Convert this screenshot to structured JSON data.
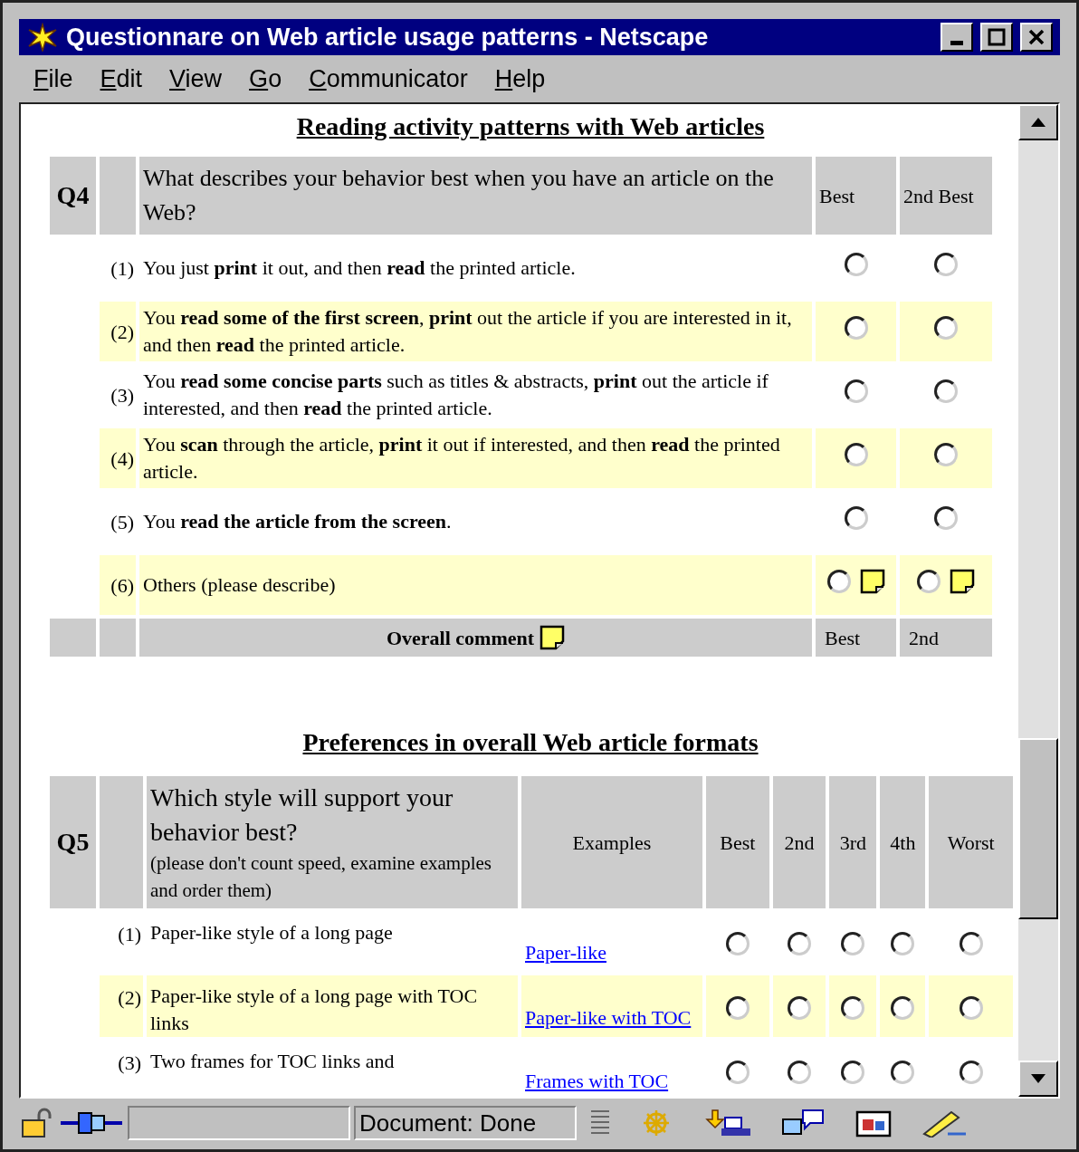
{
  "window": {
    "title": "Questionnare on Web article usage patterns - Netscape"
  },
  "menu": [
    "File",
    "Edit",
    "View",
    "Go",
    "Communicator",
    "Help"
  ],
  "section_1": {
    "title": "Reading activity patterns with Web articles",
    "question": {
      "number": "Q4",
      "text": "What describes your behavior best when you have an article on the Web?",
      "columns": [
        "Best",
        "2nd Best"
      ]
    },
    "rows": [
      {
        "label": "(1)",
        "text": "You just **print** it out, and then  **read** the printed article.",
        "highlighted": false,
        "note": false,
        "choices": [
          {
            "selected": false
          },
          {
            "selected": false
          }
        ]
      },
      {
        "label": "(2)",
        "text": "You **read some of the first screen**, **print** out the article if you are interested in it, and then **read** the printed article.",
        "highlighted": true,
        "note": false,
        "choices": [
          {
            "selected": false
          },
          {
            "selected": false
          }
        ]
      },
      {
        "label": "(3)",
        "text": "You **read some concise parts** such as titles & abstracts, **print** out the article if interested, and then **read** the printed article.",
        "highlighted": false,
        "note": false,
        "choices": [
          {
            "selected": false
          },
          {
            "selected": false
          }
        ]
      },
      {
        "label": "(4)",
        "text": "You **scan** through the article, **print** it out if interested, and then **read** the printed article.",
        "highlighted": true,
        "note": false,
        "choices": [
          {
            "selected": false
          },
          {
            "selected": false
          }
        ]
      },
      {
        "label": "(5)",
        "text": "You **read the article from the screen**.",
        "highlighted": false,
        "note": false,
        "choices": [
          {
            "selected": false
          },
          {
            "selected": false
          }
        ]
      },
      {
        "label": "(6)",
        "text": "Others (please describe)",
        "highlighted": true,
        "note": true,
        "choices": [
          {
            "selected": false
          },
          {
            "selected": false
          }
        ]
      }
    ],
    "footer": {
      "comment": "Overall comment",
      "columns": [
        "Best",
        "2nd"
      ]
    }
  },
  "section_2": {
    "title": "Preferences in overall Web article formats",
    "question": {
      "number": "Q5",
      "text": "Which style will support your behavior best?",
      "hint": "(please don't count speed, examine examples and order them)",
      "examples_header": "Examples",
      "columns": [
        "Best",
        "2nd",
        "3rd",
        "4th",
        "Worst"
      ]
    },
    "rows": [
      {
        "label": "(1)",
        "text": "Paper-like style of a long page",
        "link": "Paper-like",
        "highlighted": false,
        "choices": [
          {
            "selected": false
          },
          {
            "selected": false
          },
          {
            "selected": false
          },
          {
            "selected": false
          },
          {
            "selected": false
          }
        ]
      },
      {
        "label": "(2)",
        "text": "Paper-like style of a long page with TOC links",
        "link": "Paper-like with TOC",
        "highlighted": true,
        "choices": [
          {
            "selected": false
          },
          {
            "selected": false
          },
          {
            "selected": false
          },
          {
            "selected": false
          },
          {
            "selected": false
          }
        ]
      },
      {
        "label": "(3)",
        "text": "Two frames for TOC links and",
        "link": "Frames with TOC",
        "highlighted": false,
        "choices": [
          {
            "selected": false
          },
          {
            "selected": false
          },
          {
            "selected": false
          },
          {
            "selected": false
          },
          {
            "selected": false
          }
        ]
      }
    ]
  },
  "status_bar": {
    "text": "Document: Done"
  }
}
